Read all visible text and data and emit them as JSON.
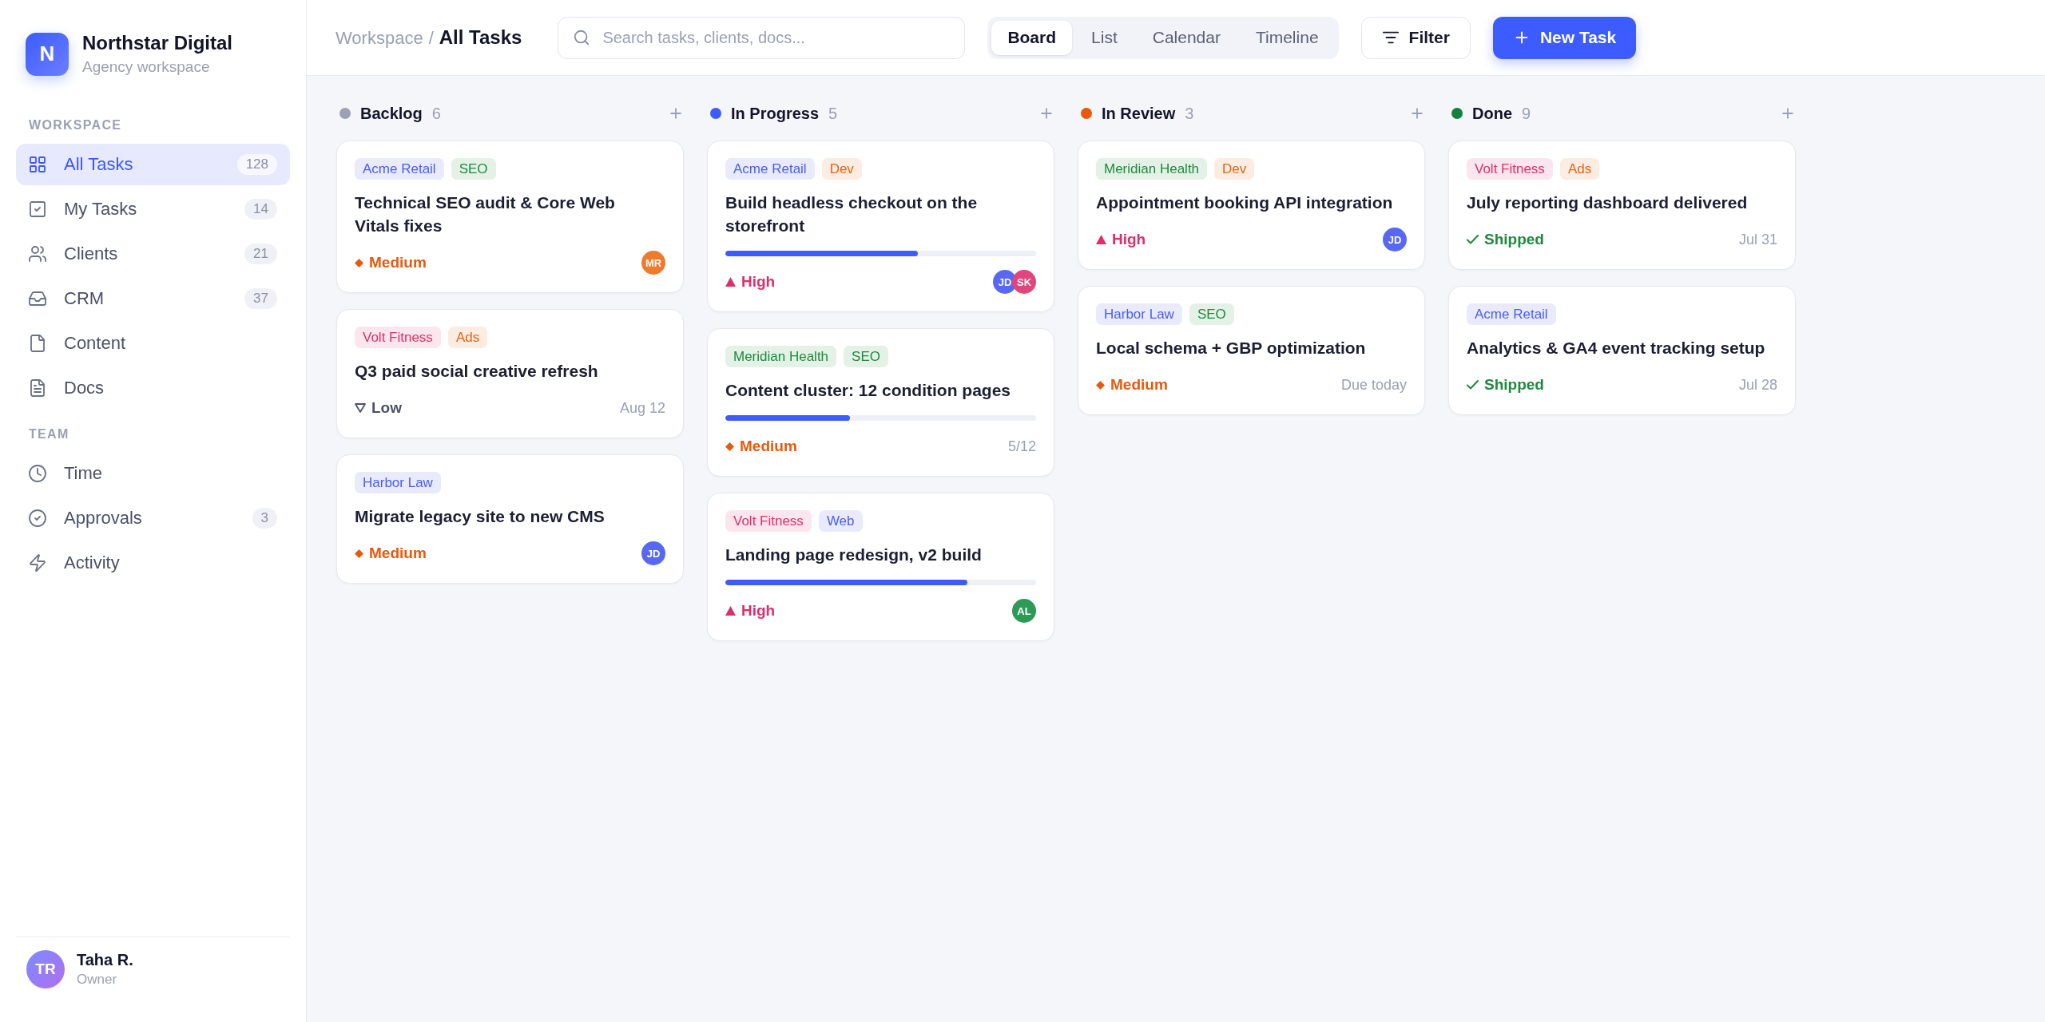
{
  "sidebar": {
    "brand": {
      "mark": "N",
      "name": "Northstar Digital",
      "subtitle": "Agency workspace"
    },
    "sections": [
      {
        "heading": "WORKSPACE",
        "items": [
          {
            "label": "All Tasks",
            "count": "128",
            "selected": true
          },
          {
            "label": "My Tasks",
            "count": "14",
            "selected": false
          },
          {
            "label": "Clients",
            "count": "21",
            "selected": false
          },
          {
            "label": "CRM",
            "count": "37",
            "selected": false
          },
          {
            "label": "Content",
            "selected": false
          },
          {
            "label": "Docs",
            "selected": false
          }
        ]
      },
      {
        "heading": "TEAM",
        "items": [
          {
            "label": "Time",
            "selected": false
          },
          {
            "label": "Approvals",
            "count": "3",
            "selected": false
          },
          {
            "label": "Activity",
            "selected": false
          }
        ]
      }
    ],
    "user": {
      "initials": "TR",
      "name": "Taha R.",
      "role": "Owner"
    }
  },
  "topbar": {
    "breadcrumb": {
      "parent": "Workspace",
      "separator": "/",
      "current": "All Tasks"
    },
    "search": {
      "placeholder": "Search tasks, clients, docs..."
    },
    "views": [
      {
        "label": "Board",
        "selected": true
      },
      {
        "label": "List",
        "selected": false
      },
      {
        "label": "Calendar",
        "selected": false
      },
      {
        "label": "Timeline",
        "selected": false
      }
    ],
    "filter_button": "Filter",
    "new_task_button": "New Task"
  },
  "board": {
    "columns": [
      {
        "title": "Backlog",
        "count": "6",
        "color": "#9ca1b3",
        "cards": [
          {
            "tags": [
              {
                "label": "Acme Retail",
                "color": "#4a5cf0"
              },
              {
                "label": "SEO",
                "color": "#1e8a3c"
              }
            ],
            "title": "Technical SEO audit & Core Web Vitals fixes",
            "status": {
              "kind": "medium",
              "label": "Medium"
            },
            "assignees": [
              {
                "initials": "MR",
                "color": "#ef7a2c"
              }
            ]
          },
          {
            "tags": [
              {
                "label": "Volt Fitness",
                "color": "#db2f6b"
              },
              {
                "label": "Ads",
                "color": "#e8610f"
              }
            ],
            "title": "Q3 paid social creative refresh",
            "status": {
              "kind": "low",
              "label": "Low"
            },
            "meta": "Aug 12"
          },
          {
            "tags": [
              {
                "label": "Harbor Law",
                "color": "#4a5cf0"
              }
            ],
            "title": "Migrate legacy site to new CMS",
            "status": {
              "kind": "medium",
              "label": "Medium"
            },
            "assignees": [
              {
                "initials": "JD",
                "color": "#5668f4"
              }
            ]
          }
        ]
      },
      {
        "title": "In Progress",
        "count": "5",
        "color": "#3d5cff",
        "cards": [
          {
            "tags": [
              {
                "label": "Acme Retail",
                "color": "#4a5cf0"
              },
              {
                "label": "Dev",
                "color": "#e8610f"
              }
            ],
            "title": "Build headless checkout on the storefront",
            "level": 0.62,
            "status": {
              "kind": "high",
              "label": "High"
            },
            "assignees": [
              {
                "initials": "JD",
                "color": "#5668f4"
              },
              {
                "initials": "SK",
                "color": "#e0457b"
              }
            ]
          },
          {
            "tags": [
              {
                "label": "Meridian Health",
                "color": "#1e8a3c"
              },
              {
                "label": "SEO",
                "color": "#1e8a3c"
              }
            ],
            "title": "Content cluster: 12 condition pages",
            "level": 0.4,
            "status": {
              "kind": "medium",
              "label": "Medium"
            },
            "meta": "5/12"
          },
          {
            "tags": [
              {
                "label": "Volt Fitness",
                "color": "#db2f6b"
              },
              {
                "label": "Web",
                "color": "#4a5cf0"
              }
            ],
            "title": "Landing page redesign, v2 build",
            "level": 0.78,
            "status": {
              "kind": "high",
              "label": "High"
            },
            "assignees": [
              {
                "initials": "AL",
                "color": "#2e9a58"
              }
            ]
          }
        ]
      },
      {
        "title": "In Review",
        "count": "3",
        "color": "#ea580c",
        "cards": [
          {
            "tags": [
              {
                "label": "Meridian Health",
                "color": "#1e8a3c"
              },
              {
                "label": "Dev",
                "color": "#e8610f"
              }
            ],
            "title": "Appointment booking API integration",
            "status": {
              "kind": "high",
              "label": "High"
            },
            "assignees": [
              {
                "initials": "JD",
                "color": "#5668f4"
              }
            ]
          },
          {
            "tags": [
              {
                "label": "Harbor Law",
                "color": "#4a5cf0"
              },
              {
                "label": "SEO",
                "color": "#1e8a3c"
              }
            ],
            "title": "Local schema + GBP optimization",
            "status": {
              "kind": "medium",
              "label": "Medium"
            },
            "meta": "Due today"
          }
        ]
      },
      {
        "title": "Done",
        "count": "9",
        "color": "#15803d",
        "cards": [
          {
            "tags": [
              {
                "label": "Volt Fitness",
                "color": "#db2f6b"
              },
              {
                "label": "Ads",
                "color": "#e8610f"
              }
            ],
            "title": "July reporting dashboard delivered",
            "status": {
              "kind": "shipped",
              "label": "Shipped"
            },
            "meta": "Jul 31"
          },
          {
            "tags": [
              {
                "label": "Acme Retail",
                "color": "#4a5cf0"
              }
            ],
            "title": "Analytics & GA4 event tracking setup",
            "status": {
              "kind": "shipped",
              "label": "Shipped"
            },
            "meta": "Jul 28"
          }
        ]
      }
    ]
  }
}
